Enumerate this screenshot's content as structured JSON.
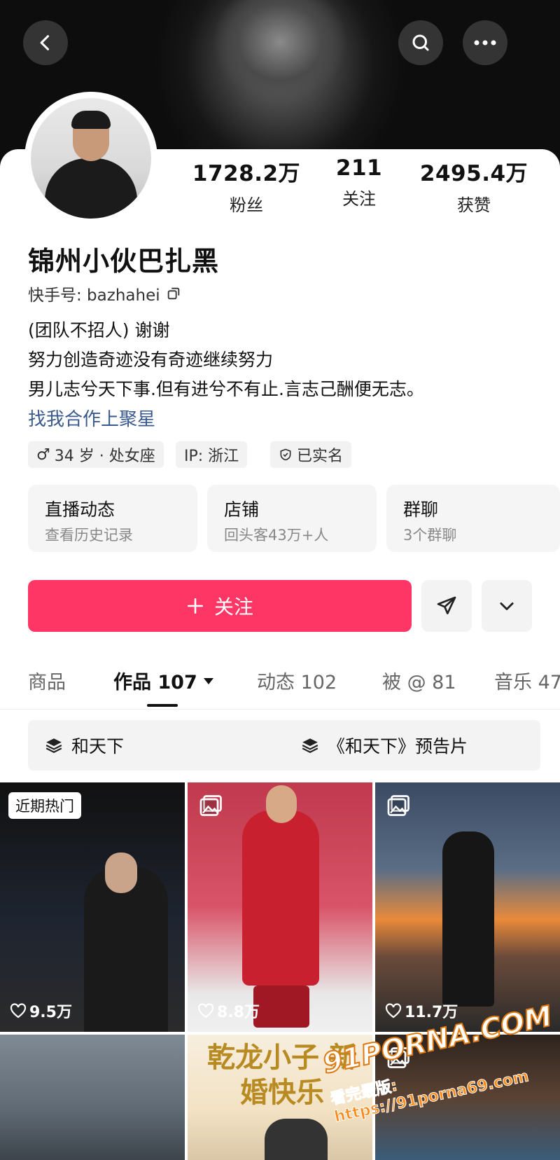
{
  "stats": [
    {
      "value": "1728.2万",
      "label": "粉丝"
    },
    {
      "value": "211",
      "label": "关注"
    },
    {
      "value": "2495.4万",
      "label": "获赞"
    }
  ],
  "profile": {
    "name": "锦州小伙巴扎黑",
    "kuaishou_id": "快手号: bazhahei",
    "bio": [
      "(团队不招人) 谢谢",
      "努力创造奇迹没有奇迹继续努力",
      "男儿志兮天下事.但有进兮不有止.言志己酬便无志。"
    ],
    "link": "找我合作上聚星",
    "tags": [
      "34 岁 · 处女座",
      "IP: 浙江",
      "已实名"
    ]
  },
  "features": [
    {
      "title": "直播动态",
      "sub": "查看历史记录"
    },
    {
      "title": "店铺",
      "sub": "回头客43万+人"
    },
    {
      "title": "群聊",
      "sub": "3个群聊"
    }
  ],
  "follow_label": "关注",
  "tabs": [
    "商品",
    "作品 107",
    "动态 102",
    "被 @ 81",
    "音乐 47"
  ],
  "collections": [
    "和天下",
    "《和天下》预告片"
  ],
  "grid": {
    "hot_badge": "近期热门",
    "likes": [
      "9.5万",
      "8.8万",
      "11.7万"
    ],
    "poster_text": "乾龙小子 新婚快乐"
  },
  "watermark": {
    "line1": "91PORNA.COM",
    "line2": "看完最版: https://91porna69.com"
  },
  "colors": {
    "accent": "#fe3666",
    "link": "#3a5a8f"
  }
}
